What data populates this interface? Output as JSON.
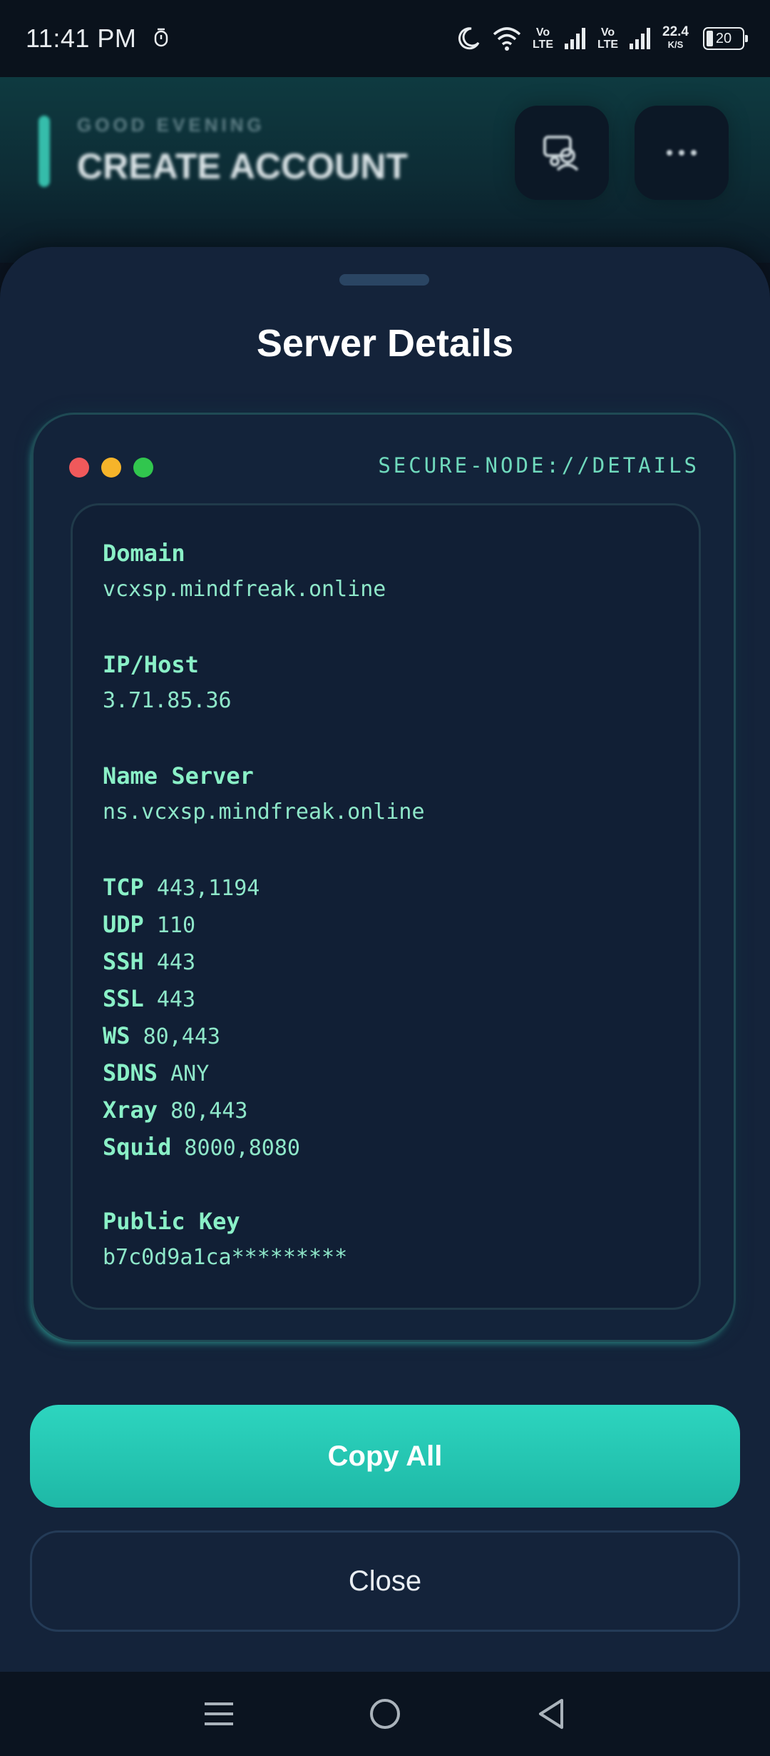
{
  "status_bar": {
    "time": "11:41 PM",
    "net1": {
      "top": "Vo",
      "bottom": "LTE"
    },
    "net2": {
      "top": "Vo",
      "bottom": "LTE"
    },
    "speed_value": "22.4",
    "speed_unit": "K/S",
    "battery": "20"
  },
  "header": {
    "greeting": "GOOD EVENING",
    "title": "CREATE ACCOUNT"
  },
  "sheet": {
    "title": "Server Details",
    "terminal_label": "SECURE-NODE://DETAILS",
    "fields": {
      "domain_label": "Domain",
      "domain_value": "vcxsp.mindfreak.online",
      "ip_label": "IP/Host",
      "ip_value": "3.71.85.36",
      "ns_label": "Name Server",
      "ns_value": "ns.vcxsp.mindfreak.online",
      "pubkey_label": "Public Key",
      "pubkey_value": "b7c0d9a1ca*********"
    },
    "ports": [
      {
        "name": "TCP",
        "value": "443,1194"
      },
      {
        "name": "UDP",
        "value": "110"
      },
      {
        "name": "SSH",
        "value": "443"
      },
      {
        "name": "SSL",
        "value": "443"
      },
      {
        "name": "WS",
        "value": "80,443"
      },
      {
        "name": "SDNS",
        "value": "ANY"
      },
      {
        "name": "Xray",
        "value": "80,443"
      },
      {
        "name": "Squid",
        "value": "8000,8080"
      }
    ],
    "copy_label": "Copy All",
    "close_label": "Close"
  },
  "colors": {
    "accent": "#2dd5bf",
    "terminal_text": "#8af0c7",
    "sheet_bg": "#14233a"
  },
  "icons": [
    "alarm-icon",
    "moon-icon",
    "wifi-icon",
    "signal-icon",
    "server-profile-icon",
    "more-icon",
    "menu-icon",
    "home-icon",
    "back-icon"
  ]
}
